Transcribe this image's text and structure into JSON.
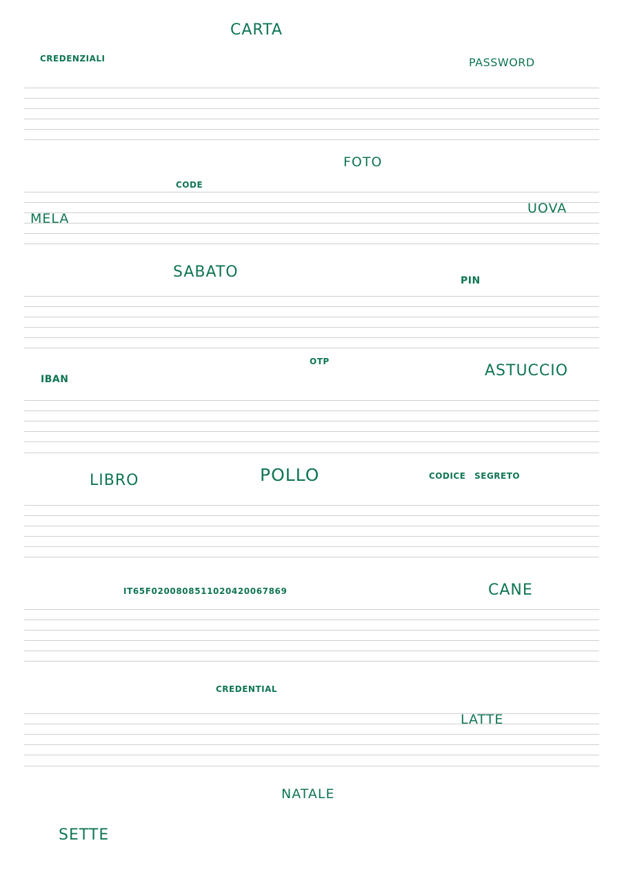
{
  "page": {
    "ink_color": "#0e7454",
    "rule_color": "#cfcfcf"
  },
  "words": {
    "carta": "CARTA",
    "credenziali": "CREDENZIALI",
    "password": "PASSWORD",
    "foto": "FOTO",
    "code": "CODE",
    "mela": "MELA",
    "uova": "UOVA",
    "sabato": "SABATO",
    "pin": "PIN",
    "otp": "OTP",
    "iban_label": "IBAN",
    "astuccio": "ASTUCCIO",
    "libro": "LIBRO",
    "pollo": "POLLO",
    "codice_segreto": "CODICE SEGRETO",
    "iban_number": "IT65F0200808511020420067869",
    "cane": "CANE",
    "credential": "CREDENTIAL",
    "latte": "LATTE",
    "natale": "NATALE",
    "sette": "SETTE"
  }
}
